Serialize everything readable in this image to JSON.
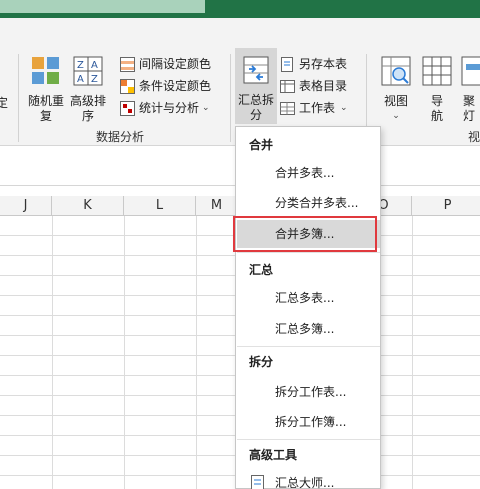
{
  "colors": {
    "accent": "#217346",
    "highlight_box": "#e0393e"
  },
  "ribbon": {
    "partial_left_label": "定",
    "random_btn": {
      "line1": "随机重",
      "line2": "复"
    },
    "sort_btn": {
      "line1": "高级排",
      "line2": "序"
    },
    "interval_color": "间隔设定颜色",
    "condition_color": "条件设定颜色",
    "stats_analysis": "统计与分析",
    "data_analysis_group": "数据分析",
    "summary_split": {
      "line1": "汇总拆",
      "line2": "分"
    },
    "save_table": "另存本表",
    "table_dir": "表格目录",
    "worksheet": "工作表",
    "view": "视图",
    "navigate": {
      "line1": "导",
      "line2": "航"
    },
    "focus": {
      "line1": "聚",
      "line2": "灯"
    },
    "partial_right_group": "视"
  },
  "columns": [
    "J",
    "K",
    "L",
    "M",
    "O",
    "P"
  ],
  "menu": {
    "sections": [
      {
        "header": "合并",
        "items": [
          "合并多表...",
          "分类合并多表...",
          "合并多簿..."
        ]
      },
      {
        "header": "汇总",
        "items": [
          "汇总多表...",
          "汇总多簿..."
        ]
      },
      {
        "header": "拆分",
        "items": [
          "拆分工作表...",
          "拆分工作簿..."
        ]
      },
      {
        "header": "高级工具",
        "items": [
          "汇总大师..."
        ]
      }
    ],
    "highlighted": "合并多簿..."
  }
}
